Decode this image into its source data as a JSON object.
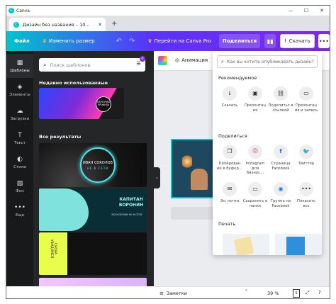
{
  "window": {
    "app_title": "Canva",
    "app_icon": "canva-logo",
    "minimize": "—",
    "maximize": "☐",
    "close": "✕"
  },
  "tab": {
    "label": "Дизайн без названия – 10...",
    "close": "✕",
    "new_tab": "+"
  },
  "header": {
    "file": "Файл",
    "resize": "Изменить размер",
    "undo": "↶",
    "redo": "↷",
    "go_pro": "Перейти на Canva Pro",
    "share": "Поделиться",
    "download": "Скачать",
    "more": "•••",
    "accent_gradient": [
      "#00c4cc",
      "#5a32fa",
      "#7d2ae8"
    ]
  },
  "rail": {
    "items": [
      {
        "label": "Шаблоны",
        "icon": "templates-icon",
        "glyph": "▦"
      },
      {
        "label": "Элементы",
        "icon": "elements-icon",
        "glyph": "◈"
      },
      {
        "label": "Загрузки",
        "icon": "uploads-icon",
        "glyph": "☁"
      },
      {
        "label": "Текст",
        "icon": "text-icon",
        "glyph": "T"
      },
      {
        "label": "Стили",
        "icon": "styles-icon",
        "glyph": "◐"
      },
      {
        "label": "Фон",
        "icon": "background-icon",
        "glyph": "▨"
      },
      {
        "label": "Еще",
        "icon": "more-icon",
        "glyph": "•••"
      }
    ]
  },
  "panel": {
    "search_placeholder": "Поиск шаблонов",
    "filter_badge": "0",
    "recent_heading": "Недавно использованные",
    "recent_badge_text": "КАРТОЧКИ ПРОФИЛЬ",
    "results_heading": "Все результаты",
    "template1_title": "ИВАН СОКОЛОВ",
    "template1_sub": "НЕ В СЕТИ",
    "template2_title": "КАПИТАН ВОРОНИН",
    "template2_sub": "ЭКСКЛЮЗИВ\nНЕ В СЕТИ",
    "template3_text": "СНОВА УВИДИМСЯ"
  },
  "canvas": {
    "animation": "Анимация",
    "collapse": "‹"
  },
  "bottom": {
    "notes": "Заметки",
    "caret": "⌃",
    "zoom": "39 %",
    "page": "1",
    "fullscreen": "⤢",
    "help": "?"
  },
  "share_popup": {
    "search_placeholder": "Как вы хотите опубликовать дизайн?",
    "recommended_heading": "Рекомендуемое",
    "recommended": [
      {
        "label": "Скачать",
        "icon": "download-icon",
        "glyph": "⭳"
      },
      {
        "label": "Презентац ия",
        "icon": "present-icon",
        "glyph": "▣"
      },
      {
        "label": "Поделитьс я ссылкой",
        "icon": "link-icon",
        "glyph": "⛓"
      },
      {
        "label": "Презентац ия и запись",
        "icon": "record-icon",
        "glyph": "▭"
      }
    ],
    "share_heading": "Поделиться",
    "share": [
      {
        "label": "Копирован ие в буфер...",
        "icon": "copy-icon",
        "glyph": "❐"
      },
      {
        "label": "Instagram для бизнес...",
        "icon": "instagram-icon",
        "glyph": "◎"
      },
      {
        "label": "Страница Facebook",
        "icon": "facebook-icon",
        "glyph": "f"
      },
      {
        "label": "Твиттер",
        "icon": "twitter-icon",
        "glyph": "🐦"
      }
    ],
    "share2": [
      {
        "label": "Эл. почта",
        "icon": "email-icon",
        "glyph": "✉"
      },
      {
        "label": "Сохранить в папке",
        "icon": "folder-icon",
        "glyph": "▭"
      },
      {
        "label": "Группа на Facebook",
        "icon": "facebook-group-icon",
        "glyph": "◉"
      },
      {
        "label": "Показать все",
        "icon": "show-all-icon",
        "glyph": "•••"
      }
    ],
    "print_heading": "Печать"
  }
}
